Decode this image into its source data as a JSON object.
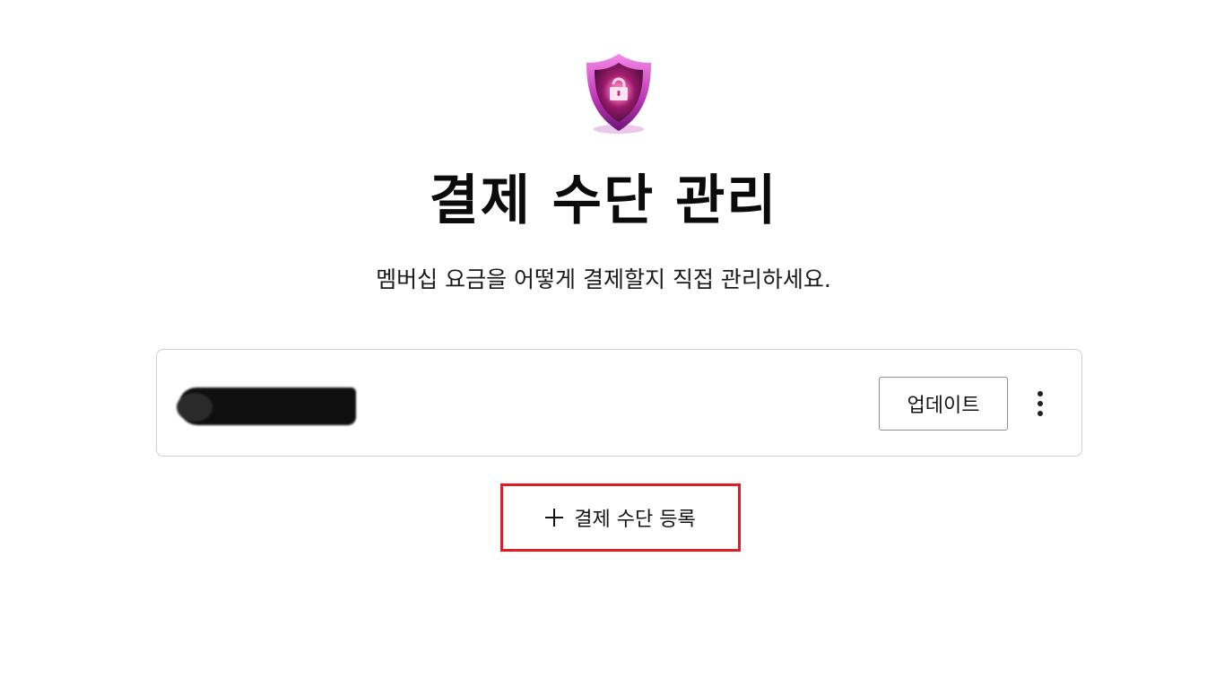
{
  "header": {
    "title": "결제 수단 관리",
    "subtitle": "멤버십 요금을 어떻게 결제할지 직접 관리하세요.",
    "icon": "shield-lock-icon"
  },
  "payment_card": {
    "info_redacted": true,
    "update_label": "업데이트",
    "more_icon": "more-vertical-icon"
  },
  "actions": {
    "add_label": "결제 수단 등록",
    "add_icon": "plus-icon",
    "highlight_color": "#e01c24"
  },
  "colors": {
    "shield_gradient_top": "#f06ad8",
    "shield_gradient_bottom": "#7a1a86"
  }
}
